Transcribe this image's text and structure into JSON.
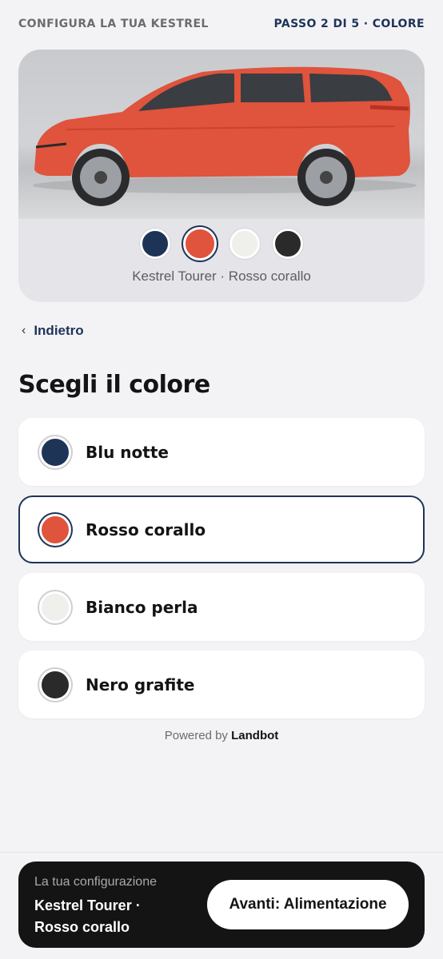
{
  "header": {
    "title": "CONFIGURA LA TUA KESTREL",
    "step": "PASSO 2 DI 5 · COLORE"
  },
  "preview": {
    "image_icon": "car-side-photo",
    "swatches": [
      {
        "name": "Blu notte",
        "color": "#1e3457",
        "selected": false
      },
      {
        "name": "Rosso corallo",
        "color": "#e0533c",
        "selected": true
      },
      {
        "name": "Bianco perla",
        "color": "#efefeb",
        "selected": false
      },
      {
        "name": "Nero grafite",
        "color": "#2a2a2a",
        "selected": false
      }
    ],
    "caption": "Kestrel Tourer · Rosso corallo"
  },
  "nav": {
    "back_label": "Indietro",
    "back_icon": "chevron-left-icon"
  },
  "main": {
    "heading": "Scegli il colore",
    "options": [
      {
        "label": "Blu notte",
        "color": "#1e3457"
      },
      {
        "label": "Rosso corallo",
        "color": "#e0533c"
      },
      {
        "label": "Bianco perla",
        "color": "#efefeb"
      },
      {
        "label": "Nero grafite",
        "color": "#2a2a2a"
      }
    ],
    "selected_option": "Rosso corallo"
  },
  "powered": {
    "prefix": "Powered by",
    "brand": "Landbot"
  },
  "summary": {
    "kicker": "La tua configurazione",
    "model": "Kestrel Tourer · Rosso corallo",
    "next_label": "Avanti: Alimentazione"
  },
  "colors": {
    "accent": "#1e3457",
    "background": "#f3f3f6",
    "footer": "#141414",
    "car_body": "#e0533c"
  }
}
